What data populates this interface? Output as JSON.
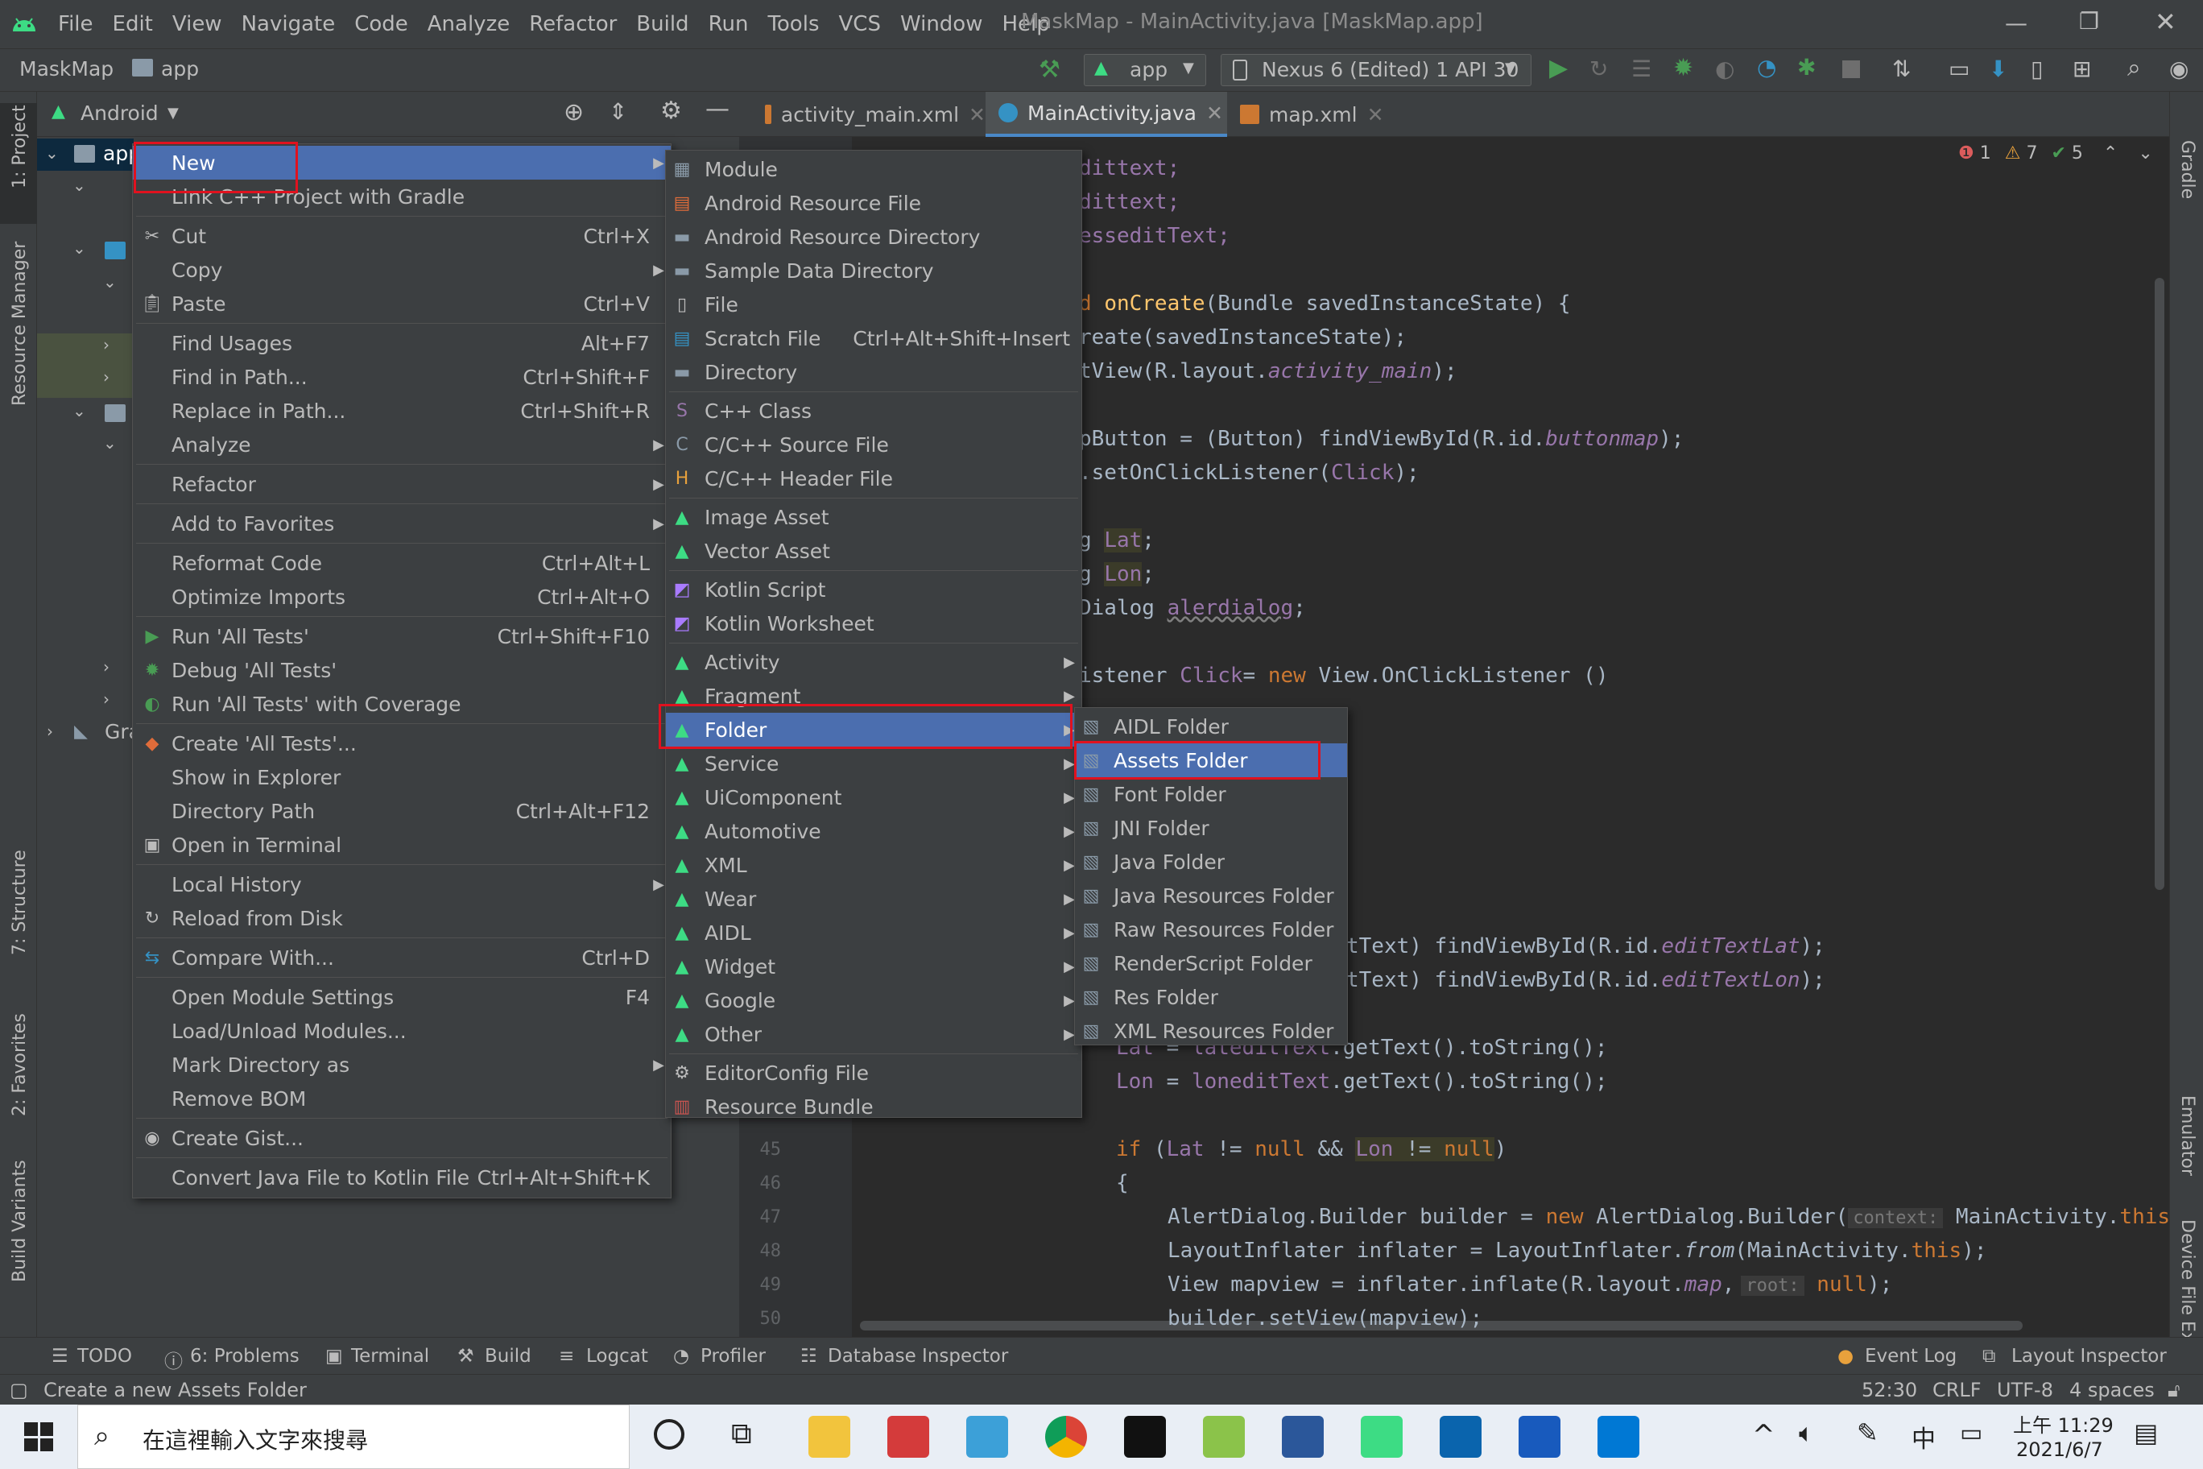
{
  "menubar": {
    "items": [
      "File",
      "Edit",
      "View",
      "Navigate",
      "Code",
      "Analyze",
      "Refactor",
      "Build",
      "Run",
      "Tools",
      "VCS",
      "Window",
      "Help"
    ],
    "window_title": "MaskMap - MainActivity.java [MaskMap.app]"
  },
  "navbar": {
    "project": "MaskMap",
    "module": "app",
    "run_config": "app",
    "device": "Nexus 6 (Edited) 1 API 30"
  },
  "project_panel": {
    "view_mode": "Android",
    "tree_root": "app",
    "tree_gradle": "Gra"
  },
  "left_strip": {
    "project": "1: Project",
    "resource_manager": "Resource Manager",
    "structure": "7: Structure",
    "favorites": "2: Favorites",
    "build_variants": "Build Variants"
  },
  "right_strip": {
    "gradle": "Gradle",
    "emulator": "Emulator",
    "device_file_explorer": "Device File Explorer"
  },
  "tabs": [
    {
      "label": "activity_main.xml"
    },
    {
      "label": "MainActivity.java"
    },
    {
      "label": "map.xml"
    }
  ],
  "inspections": {
    "errors": "1",
    "warnings": "7",
    "ok": "5"
  },
  "line_numbers": [
    "45",
    "46",
    "47",
    "48",
    "49",
    "50"
  ],
  "context_menu": {
    "items": [
      {
        "label": "New",
        "shortcut": "",
        "submenu": true
      },
      {
        "label": "Link C++ Project with Gradle",
        "shortcut": ""
      },
      {
        "label": "Cut",
        "shortcut": "Ctrl+X"
      },
      {
        "label": "Copy",
        "shortcut": "",
        "submenu": true
      },
      {
        "label": "Paste",
        "shortcut": "Ctrl+V"
      },
      {
        "label": "Find Usages",
        "shortcut": "Alt+F7"
      },
      {
        "label": "Find in Path...",
        "shortcut": "Ctrl+Shift+F"
      },
      {
        "label": "Replace in Path...",
        "shortcut": "Ctrl+Shift+R"
      },
      {
        "label": "Analyze",
        "shortcut": "",
        "submenu": true
      },
      {
        "label": "Refactor",
        "shortcut": "",
        "submenu": true
      },
      {
        "label": "Add to Favorites",
        "shortcut": "",
        "submenu": true
      },
      {
        "label": "Reformat Code",
        "shortcut": "Ctrl+Alt+L"
      },
      {
        "label": "Optimize Imports",
        "shortcut": "Ctrl+Alt+O"
      },
      {
        "label": "Run 'All Tests'",
        "shortcut": "Ctrl+Shift+F10"
      },
      {
        "label": "Debug 'All Tests'",
        "shortcut": ""
      },
      {
        "label": "Run 'All Tests' with Coverage",
        "shortcut": ""
      },
      {
        "label": "Create 'All Tests'...",
        "shortcut": ""
      },
      {
        "label": "Show in Explorer",
        "shortcut": ""
      },
      {
        "label": "Directory Path",
        "shortcut": "Ctrl+Alt+F12"
      },
      {
        "label": "Open in Terminal",
        "shortcut": ""
      },
      {
        "label": "Local History",
        "shortcut": "",
        "submenu": true
      },
      {
        "label": "Reload from Disk",
        "shortcut": ""
      },
      {
        "label": "Compare With...",
        "shortcut": "Ctrl+D"
      },
      {
        "label": "Open Module Settings",
        "shortcut": "F4"
      },
      {
        "label": "Load/Unload Modules...",
        "shortcut": ""
      },
      {
        "label": "Mark Directory as",
        "shortcut": "",
        "submenu": true
      },
      {
        "label": "Remove BOM",
        "shortcut": ""
      },
      {
        "label": "Create Gist...",
        "shortcut": ""
      },
      {
        "label": "Convert Java File to Kotlin File",
        "shortcut": "Ctrl+Alt+Shift+K"
      }
    ]
  },
  "new_menu": {
    "items": [
      {
        "label": "Module",
        "icon": "module-icon"
      },
      {
        "label": "Android Resource File",
        "icon": "resource-file-icon"
      },
      {
        "label": "Android Resource Directory",
        "icon": "folder-icon"
      },
      {
        "label": "Sample Data Directory",
        "icon": "folder-icon"
      },
      {
        "label": "File",
        "icon": "file-icon"
      },
      {
        "label": "Scratch File",
        "icon": "scratch-file-icon",
        "shortcut": "Ctrl+Alt+Shift+Insert"
      },
      {
        "label": "Directory",
        "icon": "folder-icon"
      },
      {
        "label": "C++ Class",
        "icon": "cpp-class-icon"
      },
      {
        "label": "C/C++ Source File",
        "icon": "cpp-source-icon"
      },
      {
        "label": "C/C++ Header File",
        "icon": "cpp-header-icon"
      },
      {
        "label": "Image Asset",
        "icon": "android-icon"
      },
      {
        "label": "Vector Asset",
        "icon": "android-icon"
      },
      {
        "label": "Kotlin Script",
        "icon": "kotlin-icon"
      },
      {
        "label": "Kotlin Worksheet",
        "icon": "kotlin-icon"
      },
      {
        "label": "Activity",
        "icon": "android-icon",
        "submenu": true
      },
      {
        "label": "Fragment",
        "icon": "android-icon",
        "submenu": true
      },
      {
        "label": "Folder",
        "icon": "android-icon",
        "submenu": true
      },
      {
        "label": "Service",
        "icon": "android-icon",
        "submenu": true
      },
      {
        "label": "UiComponent",
        "icon": "android-icon",
        "submenu": true
      },
      {
        "label": "Automotive",
        "icon": "android-icon",
        "submenu": true
      },
      {
        "label": "XML",
        "icon": "android-icon",
        "submenu": true
      },
      {
        "label": "Wear",
        "icon": "android-icon",
        "submenu": true
      },
      {
        "label": "AIDL",
        "icon": "android-icon",
        "submenu": true
      },
      {
        "label": "Widget",
        "icon": "android-icon",
        "submenu": true
      },
      {
        "label": "Google",
        "icon": "android-icon",
        "submenu": true
      },
      {
        "label": "Other",
        "icon": "android-icon",
        "submenu": true
      },
      {
        "label": "EditorConfig File",
        "icon": "gear-icon"
      },
      {
        "label": "Resource Bundle",
        "icon": "bundle-icon"
      }
    ]
  },
  "folder_menu": {
    "items": [
      "AIDL Folder",
      "Assets Folder",
      "Font Folder",
      "JNI Folder",
      "Java Folder",
      "Java Resources Folder",
      "Raw Resources Folder",
      "RenderScript Folder",
      "Res Folder",
      "XML Resources Folder"
    ]
  },
  "code": {
    "l1": "dittext;",
    "l2": "dittext;",
    "l3": "esseditText;",
    "l4a": "d ",
    "l4b": "onCreate",
    "l4c": "(Bundle savedInstanceState) {",
    "l5": "reate(savedInstanceState);",
    "l6a": "tView(R.layout.",
    "l6b": "activity_main",
    "l6c": ");",
    "l7a": "pButton = (Button) findViewById(R.id.",
    "l7b": "buttonmap",
    "l7c": ");",
    "l8a": ".setOnClickListener(",
    "l8b": "Click",
    "l8c": ");",
    "l9a": "g ",
    "l9b": "Lat",
    "l9c": ";",
    "l10a": "g ",
    "l10b": "Lon",
    "l10c": ";",
    "l11a": "Dialog ",
    "l11b": "alerdialog",
    "l11c": ";",
    "l12a": "istener ",
    "l12b": "Click",
    "l12c": "= ",
    "l12d": "new",
    "l12e": " View.OnClickListener ()",
    "l13a": "tText) findViewById(R.id.",
    "l13b": "editTextLat",
    "l13c": ");",
    "l14a": "tText) findViewById(R.id.",
    "l14b": "editTextLon",
    "l14c": ");",
    "l15a": "Lat",
    "l15b": " = ",
    "l15c": "lateditText",
    "l15d": ".getText().toString();",
    "l16a": "Lon",
    "l16b": " = ",
    "l16c": "loneditText",
    "l16d": ".getText().toString();",
    "l17a": "if",
    "l17b": " (",
    "l17c": "Lat",
    "l17d": " != ",
    "l17e": "null",
    "l17f": " && ",
    "l17g": "Lon",
    "l17h": " != ",
    "l17i": "null",
    "l17j": ")",
    "l18": "{",
    "l19a": "AlertDialog.Builder builder = ",
    "l19b": "new",
    "l19c": " AlertDialog.Builder(",
    "l19d": "context:",
    "l19e": " MainActivity.",
    "l19f": "this",
    "l20a": "LayoutInflater inflater = LayoutInflater.",
    "l20b": "from",
    "l20c": "(MainActivity.",
    "l20d": "this",
    "l20e": ");",
    "l21a": "View mapview = inflater.inflate(R.layout.",
    "l21b": "map",
    "l21c": ",",
    "l21d": "root:",
    "l21e": " null",
    "l21f": ");",
    "l22": "builder.setView(mapview);"
  },
  "bottom_bar": {
    "left": [
      "TODO",
      "6: Problems",
      "Terminal",
      "Build",
      "Logcat",
      "Profiler",
      "Database Inspector"
    ],
    "right": [
      "Event Log",
      "Layout Inspector"
    ]
  },
  "status_bar": {
    "message": "Create a new Assets Folder",
    "position": "52:30",
    "line_sep": "CRLF",
    "encoding": "UTF-8",
    "indent": "4 spaces"
  },
  "taskbar": {
    "search_placeholder": "在這裡輸入文字來搜尋",
    "ime": "中",
    "time": "上午 11:29",
    "date": "2021/6/7"
  },
  "colors": {
    "selection": "#4b6eaf",
    "highlight_box": "#e0121f",
    "android_green": "#3ddc84"
  }
}
